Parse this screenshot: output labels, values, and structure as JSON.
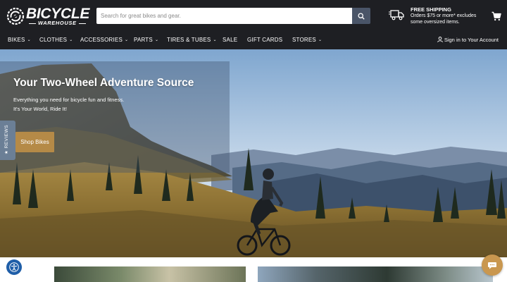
{
  "brand": {
    "name": "BICYCLE",
    "sub": "WAREHOUSE"
  },
  "search": {
    "placeholder": "Search for great bikes and gear.",
    "value": ""
  },
  "shipping": {
    "title": "FREE SHIPPING",
    "text": "Orders $75 or more* excludes some oversized items."
  },
  "nav": {
    "items": [
      {
        "label": "BIKES",
        "dropdown": true
      },
      {
        "label": "CLOTHES",
        "dropdown": true
      },
      {
        "label": "ACCESSORIES",
        "dropdown": true
      },
      {
        "label": "PARTS",
        "dropdown": true
      },
      {
        "label": "TIRES & TUBES",
        "dropdown": true
      },
      {
        "label": "SALE",
        "dropdown": false
      },
      {
        "label": "GIFT CARDS",
        "dropdown": false
      },
      {
        "label": "STORES",
        "dropdown": true
      }
    ],
    "signin": "Sign in to Your Account"
  },
  "hero": {
    "title": "Your Two-Wheel Adventure Source",
    "line1": "Everything you need for bicycle fun and fitness.",
    "line2": "It's Your World, Ride It!",
    "button": "Shop Bikes"
  },
  "reviews_tab": {
    "label": "★ REVIEWS"
  },
  "icons": {
    "search": "search-icon",
    "truck": "truck-icon",
    "cart": "cart-icon",
    "user": "user-icon",
    "accessibility": "accessibility-icon",
    "chat": "chat-icon"
  },
  "colors": {
    "header_bg": "#1e1f23",
    "search_button": "#4a5568",
    "accent": "#b58a47",
    "reviews_tab": "#6b7f96",
    "accessibility": "#1f5ea8",
    "chat": "#c9974f"
  }
}
